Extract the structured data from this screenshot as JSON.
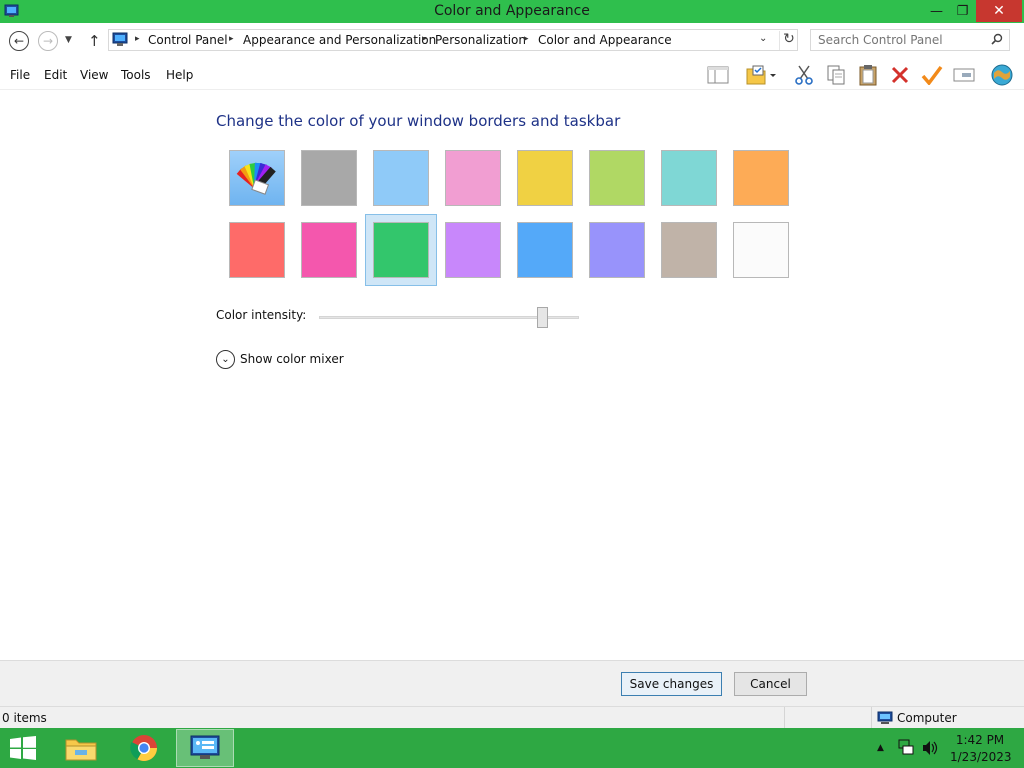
{
  "window": {
    "title": "Color and Appearance",
    "minimize": "—",
    "restore": "❐",
    "close": "✕"
  },
  "address": {
    "crumbs": [
      "Control Panel",
      "Appearance and Personalization",
      "Personalization",
      "Color and Appearance"
    ],
    "search_placeholder": "Search Control Panel"
  },
  "menu": {
    "items": [
      "File",
      "Edit",
      "View",
      "Tools",
      "Help"
    ]
  },
  "content": {
    "heading": "Change the color of your window borders and taskbar",
    "swatches": {
      "row1": [
        "auto",
        "#a8a8a8",
        "#8fcaf8",
        "#f19ed2",
        "#f0d143",
        "#b0d864",
        "#7fd7d5",
        "#fdab56"
      ],
      "row2": [
        "#fe6b69",
        "#f457ad",
        "#33c66c",
        "#c887fb",
        "#54a9f9",
        "#9893fb",
        "#c0b3a8",
        "#fbfbfb"
      ],
      "selected": "#33c66c"
    },
    "intensity_label": "Color intensity:",
    "intensity_value": 0.86,
    "mixer_label": "Show color mixer"
  },
  "footer": {
    "save_label": "Save changes",
    "cancel_label": "Cancel"
  },
  "status": {
    "items": "0 items",
    "location": "Computer"
  },
  "taskbar": {
    "time": "1:42 PM",
    "date": "1/23/2023"
  },
  "colors": {
    "titlebar": "#2fbf4d",
    "taskbar": "#2ea843",
    "heading": "#1e3287"
  }
}
